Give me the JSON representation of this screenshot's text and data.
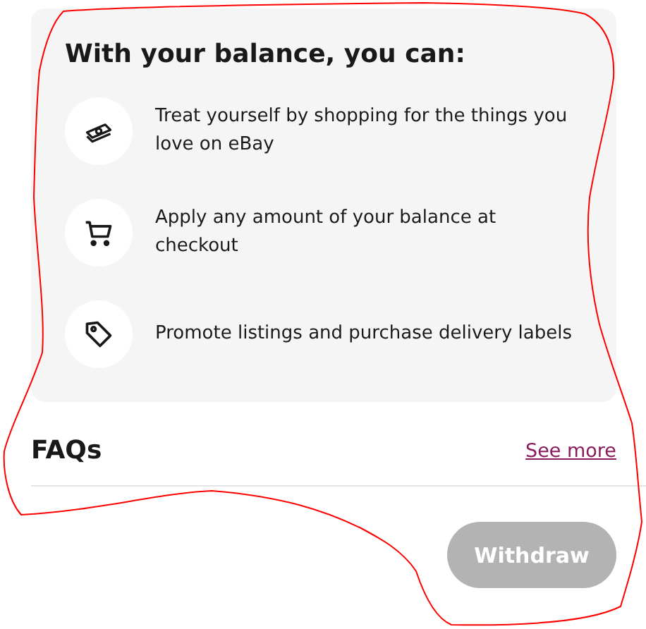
{
  "benefits": {
    "title": "With your balance, you can:",
    "items": [
      {
        "kind": "money",
        "text": "Treat yourself by shopping for the things you love on eBay"
      },
      {
        "kind": "cart",
        "text": "Apply any amount of your balance at checkout"
      },
      {
        "kind": "tag",
        "text": "Promote listings and purchase delivery labels"
      }
    ]
  },
  "faqs": {
    "title": "FAQs",
    "link": "See more"
  },
  "withdraw_button": {
    "label": "Withdraw",
    "disabled": true
  }
}
